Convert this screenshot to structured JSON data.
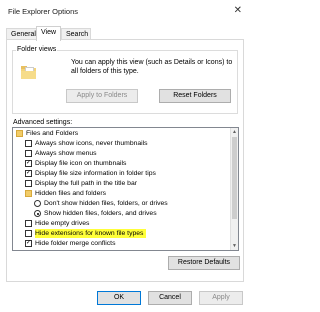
{
  "window": {
    "title": "File Explorer Options",
    "close_glyph": "✕"
  },
  "tabs": [
    "General",
    "View",
    "Search"
  ],
  "folder_views": {
    "label": "Folder views",
    "description": "You can apply this view (such as Details or Icons) to all folders of this type.",
    "apply_label": "Apply to Folders",
    "reset_label": "Reset Folders"
  },
  "advanced": {
    "label": "Advanced settings:",
    "items": [
      {
        "text": "Files and Folders",
        "kind": "folder",
        "level": 0
      },
      {
        "text": "Always show icons, never thumbnails",
        "kind": "checkbox",
        "checked": false,
        "level": 1
      },
      {
        "text": "Always show menus",
        "kind": "checkbox",
        "checked": false,
        "level": 1
      },
      {
        "text": "Display file icon on thumbnails",
        "kind": "checkbox",
        "checked": true,
        "level": 1
      },
      {
        "text": "Display file size information in folder tips",
        "kind": "checkbox",
        "checked": true,
        "level": 1
      },
      {
        "text": "Display the full path in the title bar",
        "kind": "checkbox",
        "checked": false,
        "level": 1
      },
      {
        "text": "Hidden files and folders",
        "kind": "folder",
        "level": 1
      },
      {
        "text": "Don't show hidden files, folders, or drives",
        "kind": "radio",
        "checked": false,
        "level": 2
      },
      {
        "text": "Show hidden files, folders, and drives",
        "kind": "radio",
        "checked": true,
        "level": 2
      },
      {
        "text": "Hide empty drives",
        "kind": "checkbox",
        "checked": false,
        "level": 1
      },
      {
        "text": "Hide extensions for known file types",
        "kind": "checkbox",
        "checked": false,
        "level": 1,
        "highlight": true
      },
      {
        "text": "Hide folder merge conflicts",
        "kind": "checkbox",
        "checked": true,
        "level": 1
      }
    ],
    "restore_label": "Restore Defaults"
  },
  "footer": {
    "ok": "OK",
    "cancel": "Cancel",
    "apply": "Apply"
  },
  "colors": {
    "highlight": "#ffff3a",
    "default_button_border": "#0078d7"
  }
}
